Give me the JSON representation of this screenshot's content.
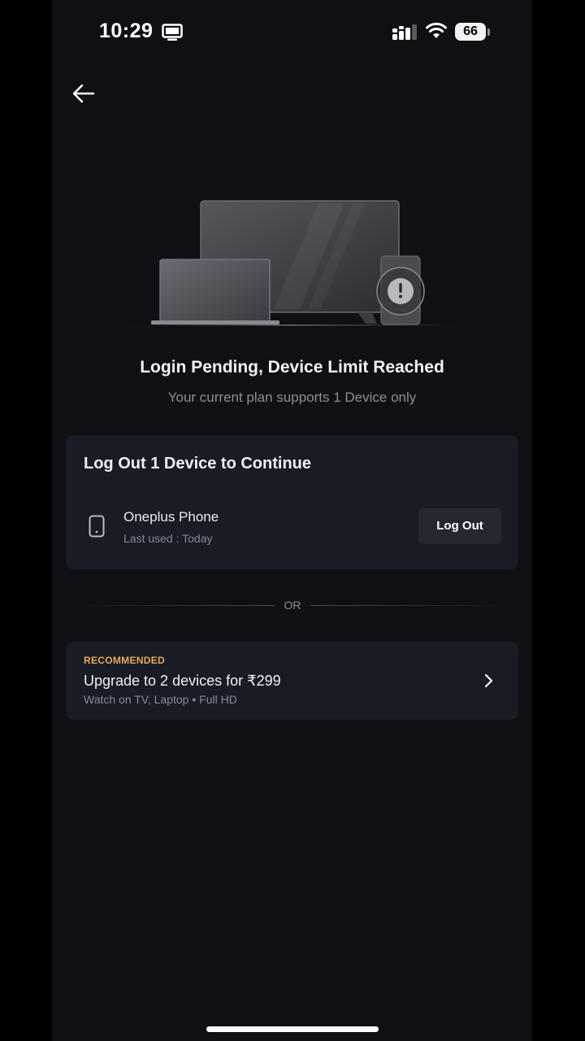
{
  "status_bar": {
    "time": "10:29",
    "battery": "66",
    "icons": [
      "screen-mirror-icon",
      "signal-icon",
      "wifi-icon",
      "battery-icon"
    ]
  },
  "nav": {
    "back_icon": "arrow-left-icon"
  },
  "illustration": {
    "icons": [
      "tv-icon",
      "laptop-icon",
      "phone-icon",
      "exclamation-icon"
    ]
  },
  "main": {
    "title": "Login Pending, Device Limit Reached",
    "subtitle": "Your current plan supports 1 Device only"
  },
  "devices_card": {
    "title": "Log Out 1 Device to Continue",
    "devices": [
      {
        "name": "Oneplus Phone",
        "last_used": "Last used : Today",
        "icon": "phone-icon",
        "action_label": "Log Out"
      }
    ]
  },
  "divider": {
    "label": "OR"
  },
  "upgrade_card": {
    "badge": "RECOMMENDED",
    "title": "Upgrade to 2 devices for ₹299",
    "subtitle": "Watch on TV, Laptop • Full HD",
    "icon": "chevron-right-icon"
  },
  "colors": {
    "background": "#0f1014",
    "card": "#191c24",
    "badge": "#e8a857",
    "muted_text": "#8b8f9c"
  }
}
